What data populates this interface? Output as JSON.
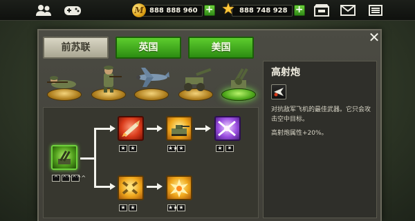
{
  "topbar": {
    "friends_icon": "friends-icon",
    "gamepad_icon": "gamepad-icon",
    "coins": {
      "amount": "888 888 960",
      "icon": "coin-icon",
      "coin_letter": "M"
    },
    "stars": {
      "amount": "888 748 928",
      "icon": "star-icon"
    },
    "shop_icon": "shop-icon",
    "mail_icon": "mail-icon",
    "menu_icon": "menu-icon"
  },
  "tabs": [
    {
      "label": "前苏联",
      "state": "inactive"
    },
    {
      "label": "英国",
      "state": "active"
    },
    {
      "label": "美国",
      "state": "active"
    }
  ],
  "close_icon": "close-icon",
  "units": [
    {
      "name": "prone-rifleman",
      "selected": false
    },
    {
      "name": "rifleman",
      "selected": false
    },
    {
      "name": "fighter-plane",
      "selected": false
    },
    {
      "name": "field-artillery",
      "selected": false
    },
    {
      "name": "anti-aircraft-gun",
      "selected": true
    }
  ],
  "info": {
    "title": "高射炮",
    "icon": "anti-air-icon",
    "description": "对抗敌军飞机的最佳武器。它只会攻击空中目标。",
    "bonus": "高射炮属性+20%。"
  },
  "tree": {
    "root": {
      "color": "green",
      "badges": [
        "^",
        "^^",
        "^^^"
      ]
    },
    "top_row": [
      {
        "color": "red",
        "badges": [
          "★",
          "★"
        ]
      },
      {
        "color": "gold",
        "badges": [
          "★★",
          "★"
        ]
      },
      {
        "color": "purple",
        "badges": [
          "★",
          "✷"
        ]
      }
    ],
    "bottom_row": [
      {
        "color": "gold",
        "badges": [
          "★",
          "★"
        ]
      },
      {
        "color": "gold",
        "badges": [
          "★★",
          "★"
        ]
      }
    ]
  },
  "colors": {
    "accent_green": "#3fae1c",
    "gold": "#f0a81c"
  }
}
